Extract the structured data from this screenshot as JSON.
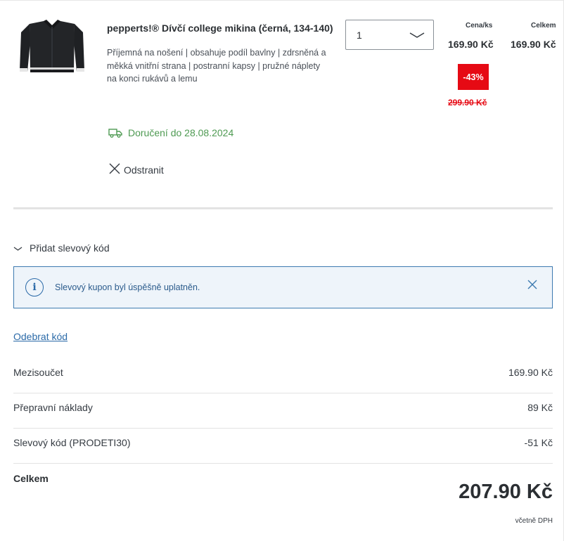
{
  "product": {
    "image_alt": "black college jacket",
    "title": "pepperts!® Dívčí college mikina (černá, 134-140)",
    "description": "Příjemná na nošení | obsahuje podíl bavlny | zdrsněná a měkká vnitřní strana | postranní kapsy | pružné náplety na konci rukávů a lemu",
    "delivery": "Doručení do 28.08.2024",
    "delivery_icon": "truck-icon",
    "remove_label": "Odstranit",
    "quantity": "1",
    "unit_price_header": "Cena/ks",
    "total_header": "Celkem",
    "unit_price": "169.90 Kč",
    "total_price": "169.90 Kč",
    "discount": "-43%",
    "old_price": "299.90 Kč"
  },
  "coupon": {
    "toggle_label": "Přidat slevový kód",
    "alert_text": "Slevový kupon byl úspěšně uplatněn.",
    "remove_code_label": "Odebrat kód"
  },
  "summary": {
    "rows": [
      {
        "label": "Mezisoučet",
        "value": "169.90 Kč"
      },
      {
        "label": "Přepravní náklady",
        "value": "89 Kč"
      },
      {
        "label": "Slevový kód (PRODETI30)",
        "value": "-51 Kč"
      }
    ],
    "total_label": "Celkem",
    "total_value": "207.90 Kč",
    "vat_note": "včetně DPH"
  },
  "colors": {
    "accent_red": "#e60a14",
    "delivery_green": "#4e9a52",
    "link_blue": "#2b6aa8",
    "alert_bg": "#eef4fa"
  }
}
